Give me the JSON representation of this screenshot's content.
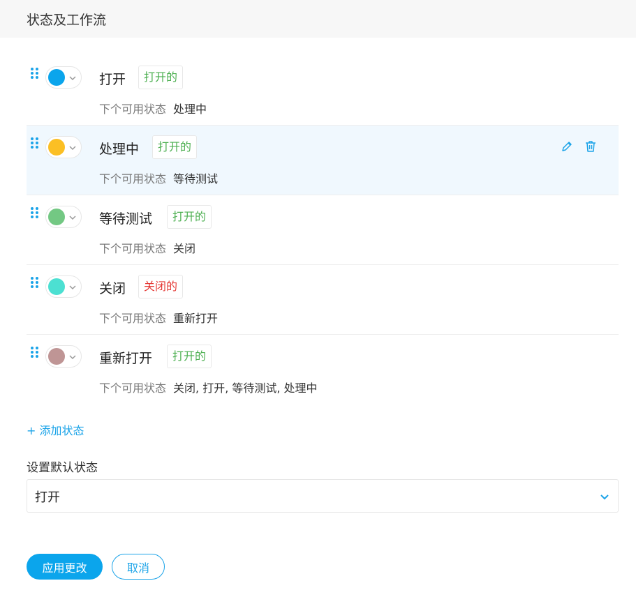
{
  "header": {
    "title": "状态及工作流"
  },
  "next_state_label": "下个可用状态",
  "colors": {
    "accent": "#1aa3e8",
    "badge_open": "#4caf50",
    "badge_closed": "#e53935",
    "row_highlight": "#f0f8fe"
  },
  "statuses": [
    {
      "name": "打开",
      "color": "#0ba5ec",
      "badge": "打开的",
      "badge_color": "#4caf50",
      "next": "处理中"
    },
    {
      "name": "处理中",
      "color": "#fbbf24",
      "badge": "打开的",
      "badge_color": "#4caf50",
      "next": "等待测试",
      "icons": [
        "pencil-icon",
        "trash-icon"
      ]
    },
    {
      "name": "等待测试",
      "color": "#73c883",
      "badge": "打开的",
      "badge_color": "#4caf50",
      "next": "关闭"
    },
    {
      "name": "关闭",
      "color": "#4ce0d2",
      "badge": "关闭的",
      "badge_color": "#e53935",
      "next": "重新打开"
    },
    {
      "name": "重新打开",
      "color": "#bf9595",
      "badge": "打开的",
      "badge_color": "#4caf50",
      "next": "关闭, 打开, 等待测试, 处理中"
    }
  ],
  "add_status_label": "+ 添加状态",
  "default_status": {
    "label": "设置默认状态",
    "value": "打开"
  },
  "buttons": {
    "apply": "应用更改",
    "cancel": "取消"
  }
}
